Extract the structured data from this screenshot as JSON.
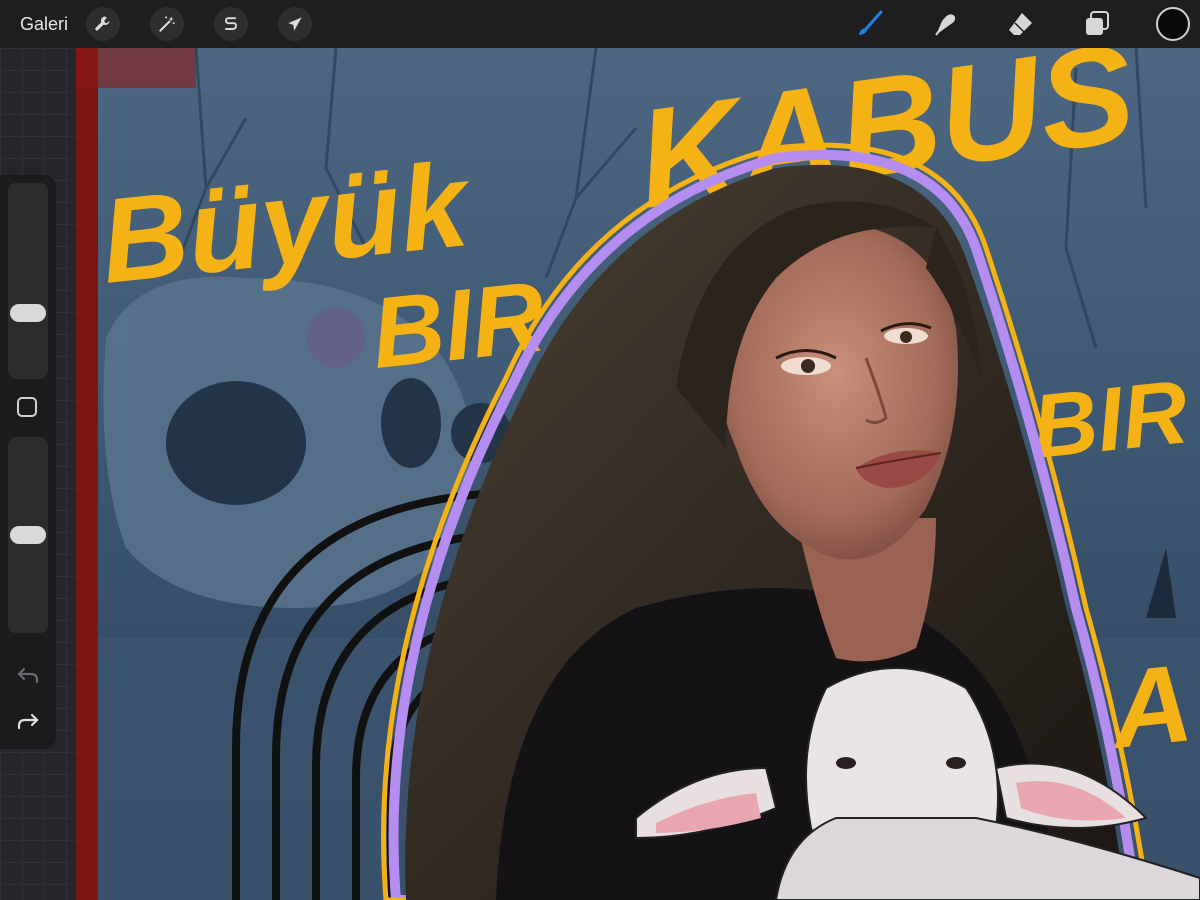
{
  "toolbar": {
    "gallery_label": "Galeri",
    "left_tools": [
      {
        "name": "actions",
        "icon": "wrench-icon"
      },
      {
        "name": "adjustments",
        "icon": "magic-wand-icon"
      },
      {
        "name": "selection",
        "icon": "selection-s-icon"
      },
      {
        "name": "transform",
        "icon": "arrow-cursor-icon"
      }
    ],
    "right_tools": [
      {
        "name": "brush",
        "icon": "brush-icon",
        "active": true
      },
      {
        "name": "smudge",
        "icon": "smudge-finger-icon"
      },
      {
        "name": "eraser",
        "icon": "eraser-icon"
      },
      {
        "name": "layers",
        "icon": "layers-icon"
      }
    ],
    "current_color": "#0a0a0a",
    "accent_color": "#1e7fe0"
  },
  "artwork": {
    "text_lines": [
      "Büyük",
      "BIR",
      "KABUS",
      "BIR",
      "A"
    ],
    "text_color": "#f5b214",
    "outline_color": "#b58cf0"
  },
  "sidebar": {
    "brush_size_level": 0.3,
    "opacity_level": 0.5
  }
}
